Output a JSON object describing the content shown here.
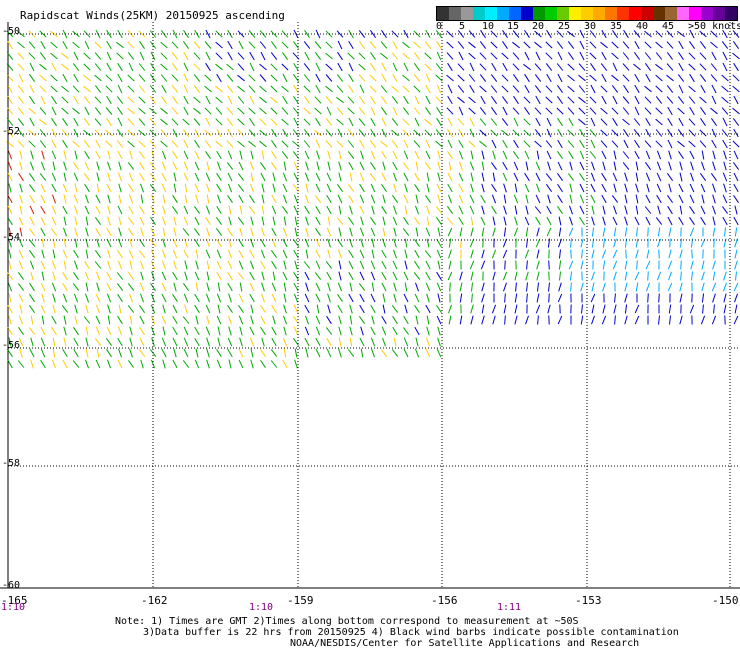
{
  "title": "Rapidscat Winds(25KM) 20150925 ascending",
  "legend": {
    "labels": [
      "0",
      "5",
      "10",
      "15",
      "20",
      "25",
      "30",
      "35",
      "40",
      "45",
      ">50 knots"
    ],
    "colors": [
      "#333333",
      "#666666",
      "#999999",
      "#00cccc",
      "#00eeff",
      "#00aaff",
      "#0066ff",
      "#0000cc",
      "#009900",
      "#00cc00",
      "#66cc00",
      "#ffee00",
      "#ffcc00",
      "#ffaa00",
      "#ff7700",
      "#ff3300",
      "#ff0000",
      "#cc0000",
      "#663300",
      "#996633",
      "#ff66ff",
      "#ff00ff",
      "#9900cc",
      "#660099",
      "#330066"
    ]
  },
  "axes": {
    "lat_labels": [
      "-50",
      "-52",
      "-54",
      "-56",
      "-58",
      "-60"
    ],
    "lon_labels": [
      "-165",
      "-162",
      "-159",
      "-156",
      "-153",
      "-150"
    ],
    "time_labels": [
      "1:10",
      "1:10",
      "1:11"
    ]
  },
  "notes": {
    "line1": "Note: 1) Times are GMT 2)Times along bottom correspond to measurement at ~50S",
    "line2": "3)Data buffer is 22 hrs from 20150925 4) Black wind barbs indicate possible contamination",
    "line3": "NOAA/NESDIS/Center for Satellite Applications and Research"
  },
  "map": {
    "speed_colors": {
      "blue": "#0000cc",
      "cyan": "#00aaff",
      "green": "#00aa00",
      "yellow": "#ffcc00",
      "red": "#cc2200"
    }
  }
}
